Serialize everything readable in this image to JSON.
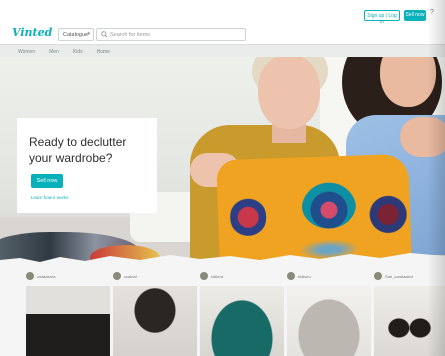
{
  "brand": {
    "logo": "Vinted",
    "accent": "#09b1ba"
  },
  "header": {
    "catalogue_label": "Catalogue",
    "search_placeholder": "Search for items",
    "signup_label": "Sign up | Log in",
    "sell_label": "Sell now",
    "help_icon": "question-icon"
  },
  "subnav": {
    "items": [
      "Women",
      "Men",
      "Kids",
      "Home"
    ]
  },
  "hero": {
    "headline": "Ready to declutter your wardrobe?",
    "cta_label": "Sell now",
    "learn_link": "Learn how it works"
  },
  "items": [
    {
      "username": "odakasma"
    },
    {
      "username": "ccatrial"
    },
    {
      "username": "lottierd"
    },
    {
      "username": "eldiseu"
    },
    {
      "username": "Sari_cardiaaled"
    }
  ]
}
